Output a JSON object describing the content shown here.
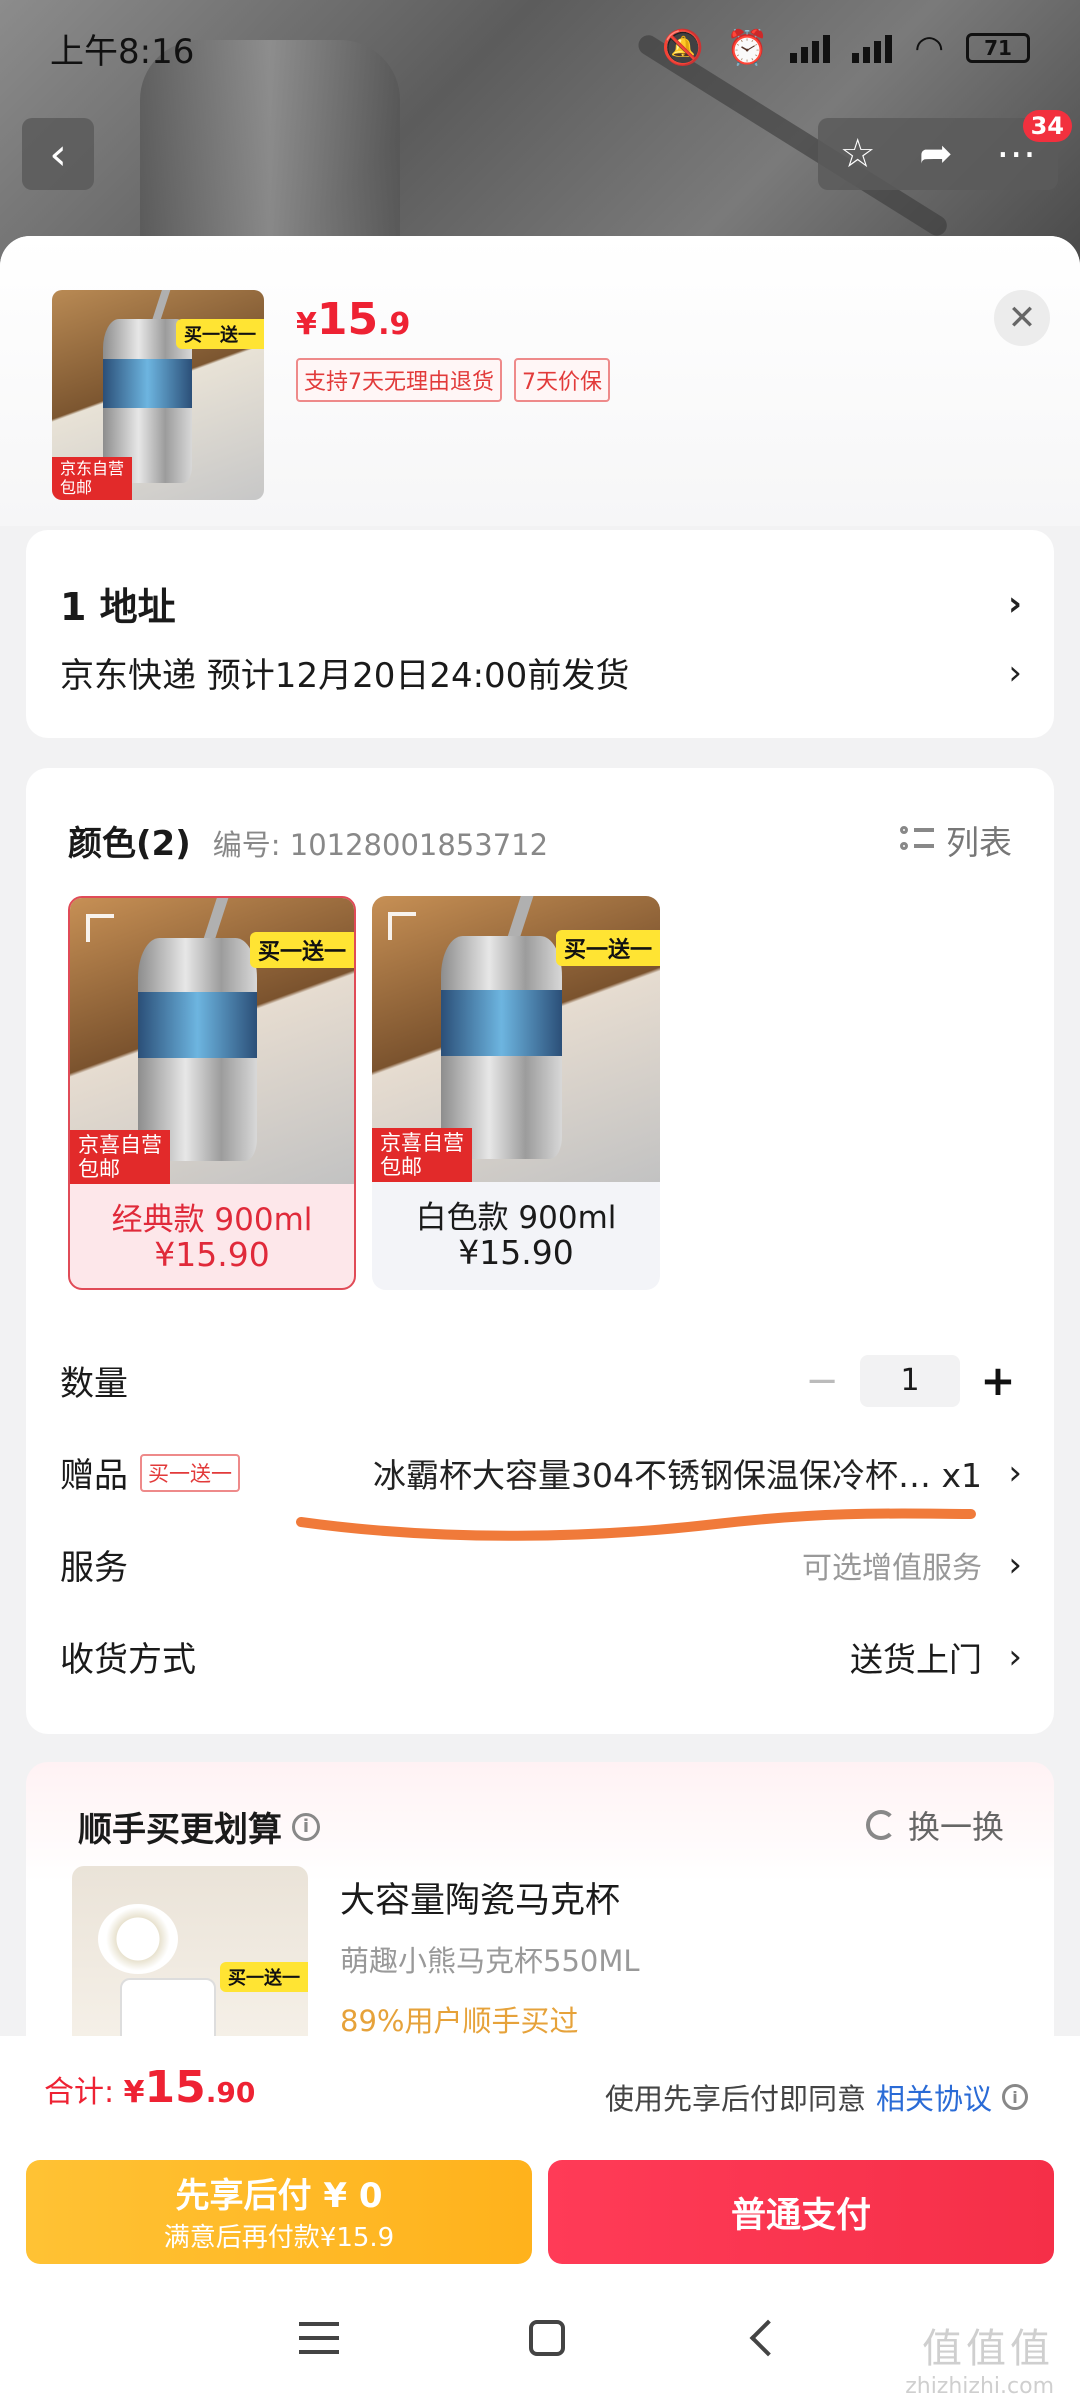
{
  "status_bar": {
    "time": "上午8:16",
    "battery": "71"
  },
  "nav": {
    "badge_count": "34"
  },
  "product": {
    "price_currency": "¥",
    "price_int": "15",
    "price_dec": ".9",
    "chips": [
      "支持7天无理由退货",
      "7天价保"
    ],
    "thumb_promo": "买一送一",
    "thumb_tag_line1": "京东自营",
    "thumb_tag_line2": "包邮"
  },
  "address": {
    "line1": "1  地址",
    "line2": "京东快递 预计12月20日24:00前发货"
  },
  "spec": {
    "title": "颜色(2)",
    "code": "编号: 10128001853712",
    "list_label": "列表",
    "variants": [
      {
        "name": "经典款 900ml",
        "price": "¥15.90",
        "promo": "买一送一",
        "tag1": "京喜自营",
        "tag2": "包邮"
      },
      {
        "name": "白色款 900ml",
        "price": "¥15.90",
        "promo": "买一送一",
        "tag1": "京喜自营",
        "tag2": "包邮"
      }
    ],
    "qty_label": "数量",
    "qty_minus": "−",
    "qty_value": "1",
    "qty_plus": "+",
    "gift_label": "赠品",
    "gift_tag": "买一送一",
    "gift_name": "冰霸杯大容量304不锈钢保温保冷杯… x1",
    "service_label": "服务",
    "service_value": "可选增值服务",
    "delivery_label": "收货方式",
    "delivery_value": "送货上门"
  },
  "recommend": {
    "title": "顺手买更划算",
    "refresh": "换一换",
    "item_name": "大容量陶瓷马克杯",
    "item_sub": "萌趣小熊马克杯550ML",
    "item_stat": "89%用户顺手买过",
    "img_promo": "买一送一"
  },
  "bottom": {
    "total_label": "合计: ",
    "total_cur": "¥",
    "total_int": "15",
    "total_dec": ".90",
    "agree_text": "使用先享后付即同意",
    "agree_link": "相关协议",
    "pay_later_l1": "先享后付 ¥ 0",
    "pay_later_l2": "满意后再付款¥15.9",
    "pay_normal": "普通支付"
  },
  "watermark": {
    "line1": "值值值",
    "line2": "zhizhizhi.com"
  },
  "colors": {
    "accent_red": "#ee2233",
    "pay_yellow": "#ffb21c",
    "link_blue": "#2a6bd6"
  }
}
